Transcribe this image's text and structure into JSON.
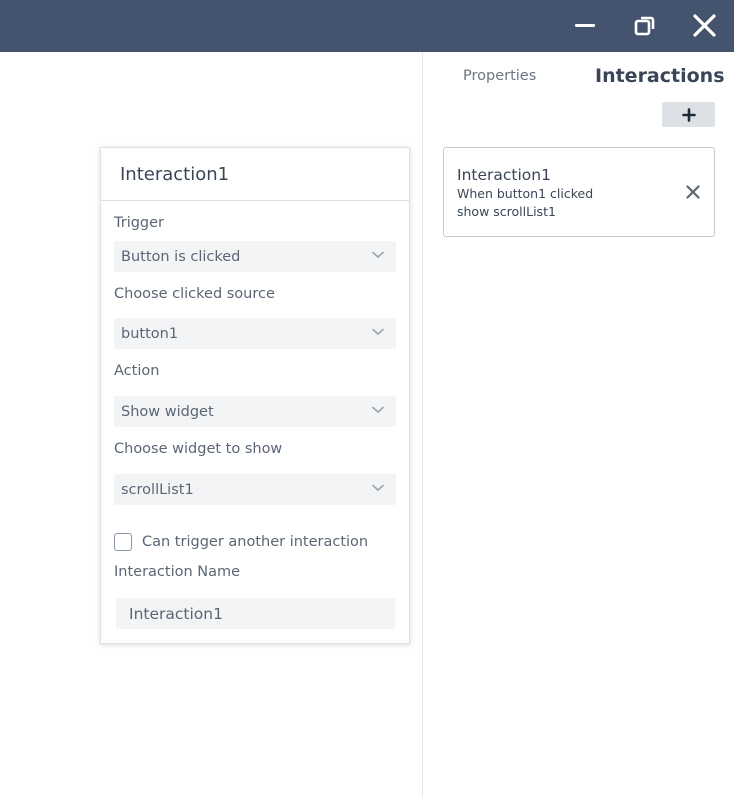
{
  "window": {
    "icons": {
      "minimize": "minimize-icon",
      "restore": "restore-icon",
      "close": "close-icon"
    },
    "titlebar_color": "#44546e"
  },
  "tabs": [
    {
      "label": "Properties",
      "active": false
    },
    {
      "label": "Interactions",
      "active": true
    }
  ],
  "interactions_panel": {
    "add_label": "+",
    "cards": [
      {
        "name": "Interaction1",
        "summary_line1": "When button1 clicked",
        "summary_line2": "show scrollList1",
        "remove_icon": "close-icon"
      }
    ]
  },
  "editor": {
    "title": "Interaction1",
    "trigger": {
      "label": "Trigger",
      "value": "Button is clicked"
    },
    "source": {
      "label": "Choose clicked source",
      "value": "button1"
    },
    "action": {
      "label": "Action",
      "value": "Show widget"
    },
    "widget": {
      "label": "Choose widget to show",
      "value": "scrollList1"
    },
    "can_trigger": {
      "label": "Can trigger another interaction",
      "checked": false
    },
    "name_field": {
      "label": "Interaction Name",
      "value": "Interaction1"
    }
  }
}
